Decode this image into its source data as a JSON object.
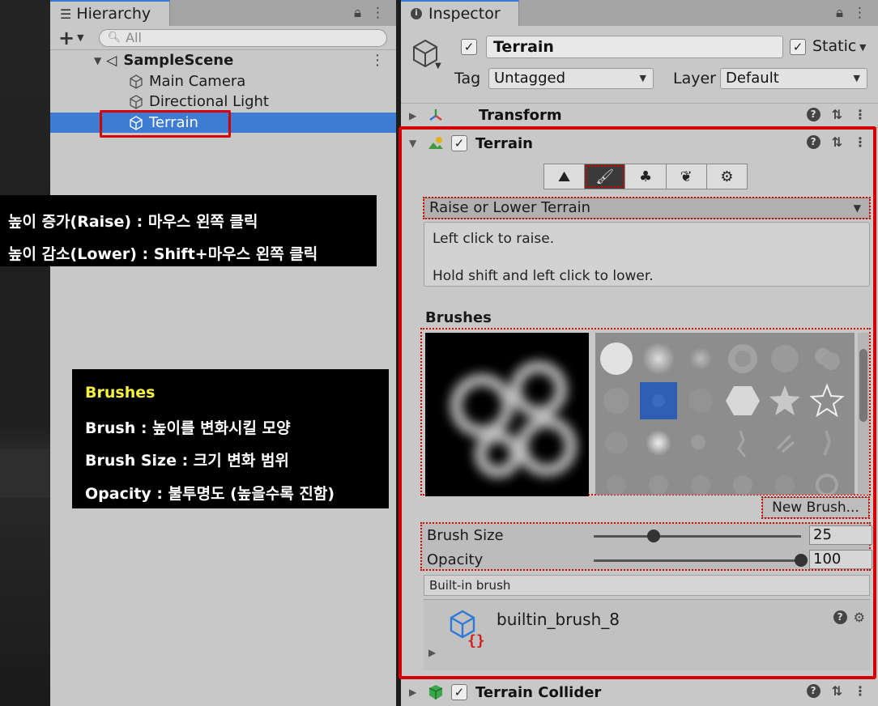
{
  "hierarchy": {
    "tab_title": "Hierarchy",
    "search_placeholder": "All",
    "scene_name": "SampleScene",
    "items": [
      {
        "label": "Main Camera"
      },
      {
        "label": "Directional Light"
      },
      {
        "label": "Terrain",
        "selected": true
      }
    ]
  },
  "inspector": {
    "tab_title": "Inspector",
    "object_name": "Terrain",
    "static_label": "Static",
    "tag_label": "Tag",
    "tag_value": "Untagged",
    "layer_label": "Layer",
    "layer_value": "Default",
    "components": {
      "transform": "Transform",
      "terrain": "Terrain",
      "terrain_collider": "Terrain Collider"
    },
    "tool_mode": "Raise or Lower Terrain",
    "help_line1": "Left click to raise.",
    "help_line2": "Hold shift and left click to lower.",
    "brushes_label": "Brushes",
    "new_brush_button": "New Brush...",
    "brush_size_label": "Brush Size",
    "brush_size_value": "25",
    "brush_size_fraction": 0.29,
    "opacity_label": "Opacity",
    "opacity_value": "100",
    "opacity_fraction": 1.0,
    "builtin_label": "Built-in brush",
    "brush_asset_name": "builtin_brush_8"
  },
  "overlays": {
    "raise_line": "높이 증가(Raise) : 마우스 왼쪽 클릭",
    "lower_line": "높이 감소(Lower) : Shift+마우스 왼쪽 클릭",
    "brushes_title": "Brushes",
    "brush_line": "Brush : 높이를 변화시킬 모양",
    "brush_size_line": "Brush Size : 크기 변화 범위",
    "opacity_line": "Opacity : 불투명도 (높을수록 진함)"
  },
  "colors": {
    "selection_blue": "#3e7bd2",
    "annotation_red": "#d40000",
    "overlay_yellow": "#f4f140"
  }
}
